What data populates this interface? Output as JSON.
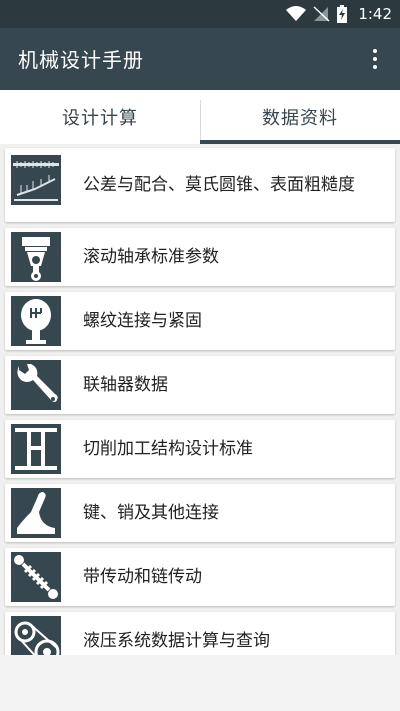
{
  "status_bar": {
    "time": "1:42"
  },
  "app_bar": {
    "title": "机械设计手册"
  },
  "tabs": [
    {
      "label": "设计计算",
      "selected": false
    },
    {
      "label": "数据资料",
      "selected": true
    }
  ],
  "items": [
    {
      "label": "公差与配合、莫氏圆锥、表面粗糙度",
      "icon": "tolerance-chart-icon"
    },
    {
      "label": "滚动轴承标准参数",
      "icon": "bearing-icon"
    },
    {
      "label": "螺纹连接与紧固",
      "icon": "gear-shift-knob-icon"
    },
    {
      "label": "联轴器数据",
      "icon": "wrench-icon"
    },
    {
      "label": "切削加工结构设计标准",
      "icon": "beam-structure-icon"
    },
    {
      "label": "键、销及其他连接",
      "icon": "lever-icon"
    },
    {
      "label": "带传动和链传动",
      "icon": "spring-shock-icon"
    },
    {
      "label": "液压系统数据计算与查询",
      "icon": "belt-pulley-icon"
    }
  ],
  "colors": {
    "primary": "#37474f",
    "status_bar": "#2c3a40",
    "background": "#f0f0f0"
  }
}
